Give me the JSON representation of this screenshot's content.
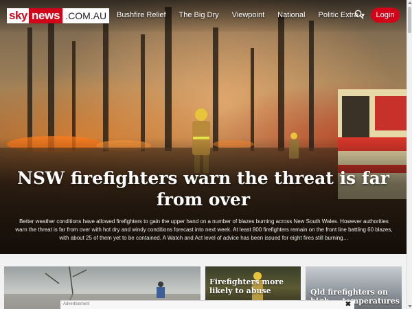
{
  "header": {
    "logo": {
      "sky": "sky",
      "news": "news",
      "domain": ".COM.AU"
    },
    "nav": [
      {
        "label": "Bushfire Relief"
      },
      {
        "label": "The Big Dry"
      },
      {
        "label": "Viewpoint"
      },
      {
        "label": "National"
      },
      {
        "label": "Politic Extra"
      }
    ],
    "search_icon": "search-icon",
    "login_label": "Login"
  },
  "hero": {
    "headline": "NSW firefighters warn the threat is far from over",
    "summary": "Better weather conditions have allowed firefighters to gain the upper hand on a number of blazes burning across New South Wales. However authorities warn the threat is far from over with hot dry and windy conditions forecast into next week. At least 800 firefighters remain on the front line battling 60 blazes, with about 25 of them yet to be contained. A Watch and Act level of advice has been issued for eight fires still burning…"
  },
  "cards": [
    {
      "title": ""
    },
    {
      "title": "Firefighters more likely to abuse"
    },
    {
      "title": "Qld firefighters on high … temperatures"
    }
  ],
  "ad": {
    "label": "Advertisement",
    "close": "✖"
  },
  "colors": {
    "brand_red": "#d2041a"
  }
}
